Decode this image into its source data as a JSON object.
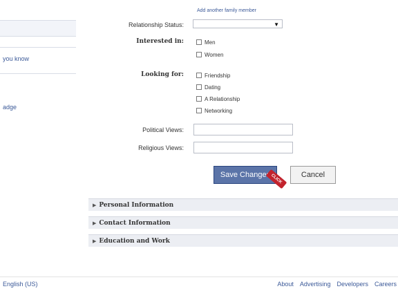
{
  "sidebar": {
    "items": [
      {
        "label": "you know"
      },
      {
        "label": "adge"
      }
    ]
  },
  "form": {
    "add_family_link": "Add another family member",
    "relationship_status_label": "Relationship Status:",
    "relationship_status_value": "",
    "interested_in_label": "Interested in:",
    "interested_in_options": [
      "Men",
      "Women"
    ],
    "looking_for_label": "Looking for:",
    "looking_for_options": [
      "Friendship",
      "Dating",
      "A Relationship",
      "Networking"
    ],
    "political_views_label": "Political Views:",
    "religious_views_label": "Religious Views:",
    "save_button": "Save Changes",
    "cancel_button": "Cancel",
    "click_callout": "CLICK"
  },
  "sections": [
    {
      "label": "Personal Information"
    },
    {
      "label": "Contact Information"
    },
    {
      "label": "Education and Work"
    }
  ],
  "footer": {
    "language": "English (US)",
    "links": [
      "About",
      "Advertising",
      "Developers",
      "Careers"
    ]
  },
  "colors": {
    "link": "#3b5998",
    "primary_button": "#5b74a8",
    "callout": "#c2232d"
  }
}
